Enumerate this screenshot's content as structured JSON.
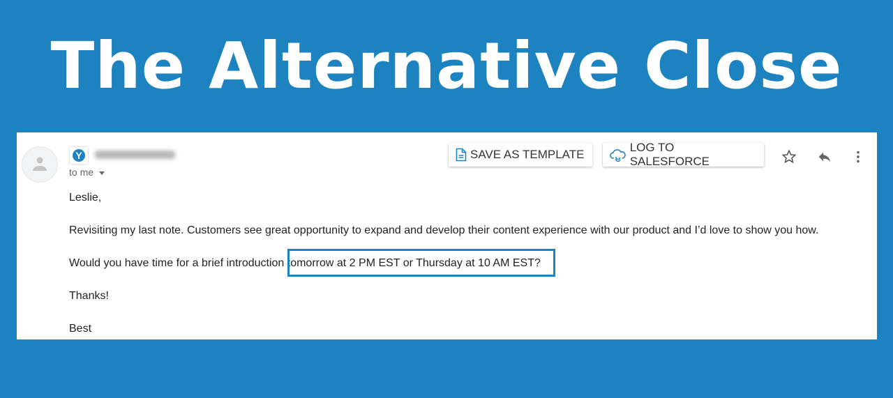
{
  "headline": "The Alternative Close",
  "email": {
    "logo_letter": "Y",
    "recipient": "to me",
    "actions": {
      "save_template": "SAVE AS TEMPLATE",
      "log_salesforce": "LOG TO SALESFORCE"
    },
    "body": [
      "Leslie,",
      "Revisiting my last note. Customers see great opportunity to expand and develop their content experience with our product and I’d love to show you how.",
      "Would you have time for a brief introduction tomorrow at 2 PM EST or Thursday at 10 AM EST?",
      "Thanks!",
      "Best"
    ]
  },
  "colors": {
    "background": "#1d83c0",
    "highlight": "#1d83c0"
  }
}
